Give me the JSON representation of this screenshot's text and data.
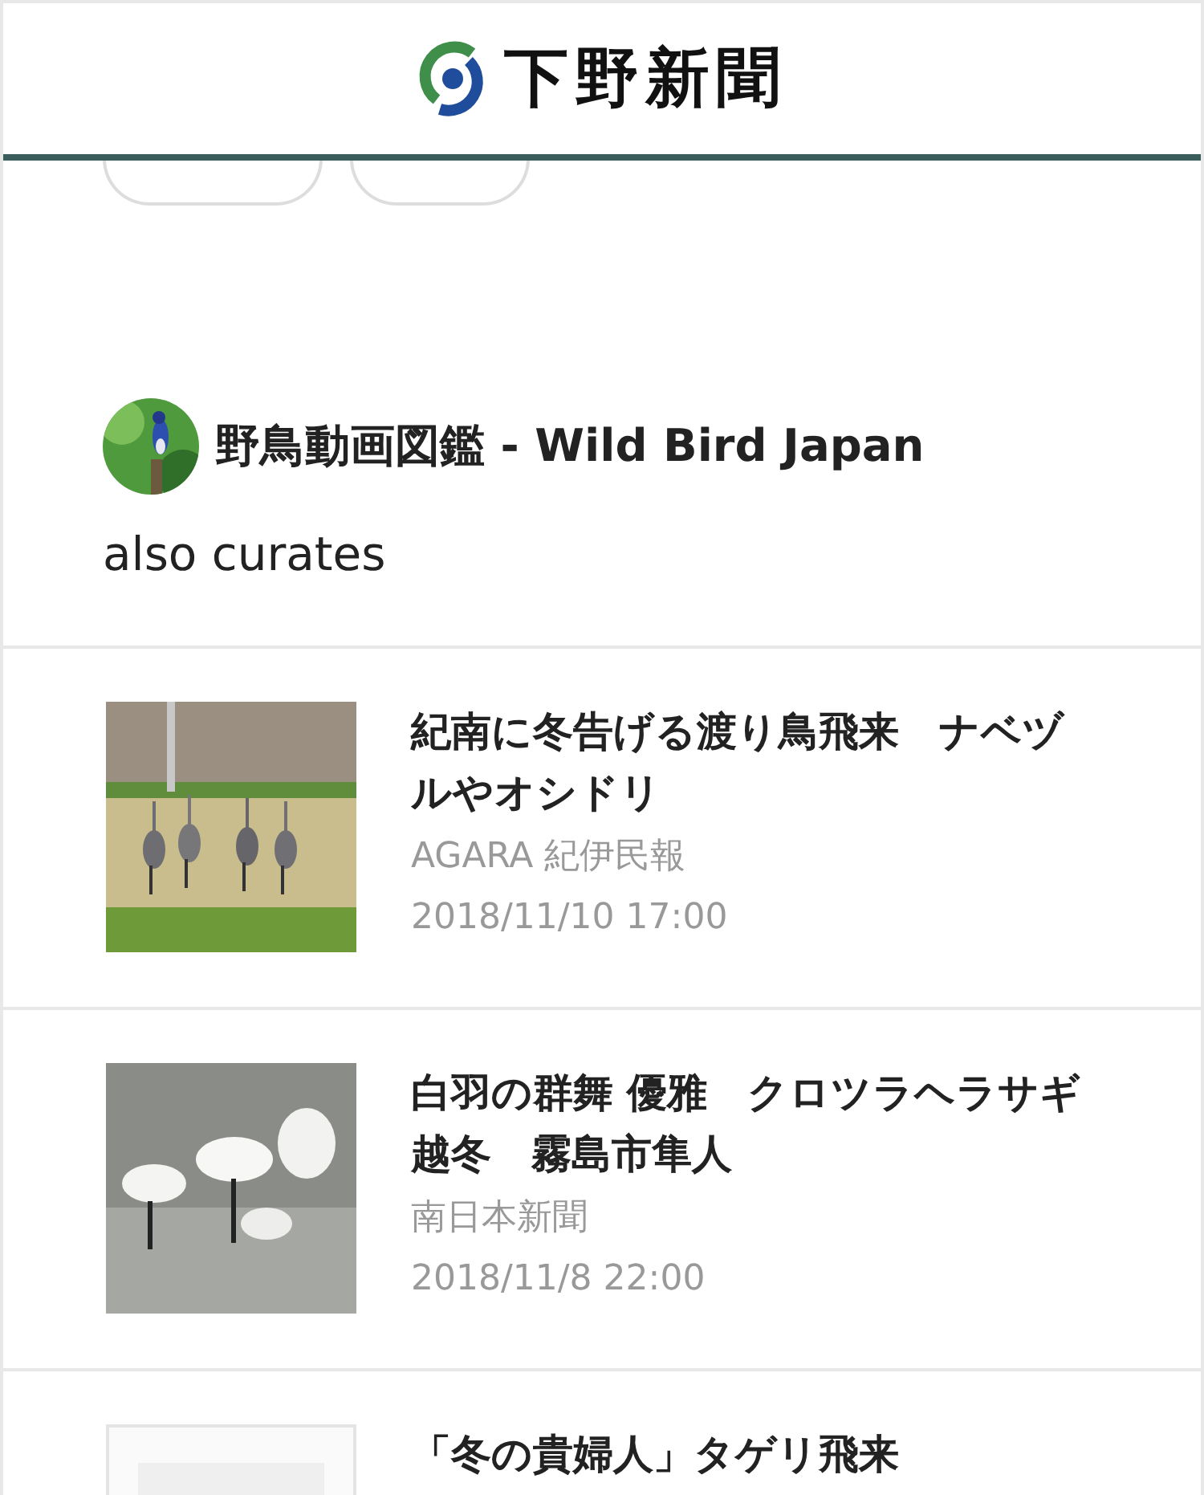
{
  "header": {
    "logo_text": "下野新聞"
  },
  "curator": {
    "name": "野鳥動画図鑑 - Wild Bird Japan",
    "caption": "also curates"
  },
  "articles": [
    {
      "title": "紀南に冬告げる渡り鳥飛来　ナベヅルやオシドリ",
      "source": "AGARA 紀伊民報",
      "time": "2018/11/10 17:00"
    },
    {
      "title": "白羽の群舞 優雅　クロツラヘラサギ越冬　霧島市隼人",
      "source": "南日本新聞",
      "time": "2018/11/8 22:00"
    },
    {
      "title": "「冬の貴婦人」タゲリ飛来"
    }
  ]
}
